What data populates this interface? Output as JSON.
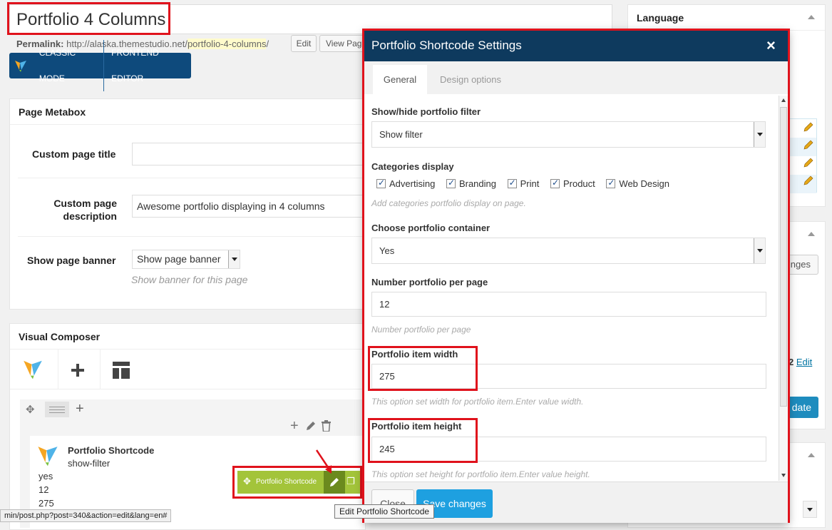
{
  "page": {
    "title": "Portfolio 4 Columns",
    "permalink_label": "Permalink:",
    "permalink_base": "http://alaska.themestudio.net/",
    "permalink_slug": "portfolio-4-columns",
    "permalink_tail": "/",
    "edit_button": "Edit",
    "view_page_button": "View Page",
    "classic_mode": "CLASSIC MODE",
    "frontend_editor": "FRONTEND EDITOR"
  },
  "metabox": {
    "title": "Page Metabox",
    "custom_title_label": "Custom page title",
    "custom_title_value": "",
    "desc_label_1": "Custom page",
    "desc_label_2": "description",
    "desc_value": "Awesome portfolio displaying in 4 columns",
    "banner_label": "Show page banner",
    "banner_value": "Show page banner",
    "banner_hint": "Show banner for this page"
  },
  "composer": {
    "title": "Visual Composer",
    "element_title": "Portfolio Shortcode",
    "element_sub": "show-filter",
    "values": [
      "yes",
      "12",
      "275"
    ],
    "toolbar_label": "Portfolio Shortcode",
    "tooltip": "Edit Portfolio Shortcode"
  },
  "status_url": "min/post.php?post=340&action=edit&lang=en#",
  "sidebar": {
    "language_title": "Language",
    "changes_fragment": "nges",
    "edit_fragment_num": "2",
    "edit_fragment_link": "Edit",
    "update_fragment": "date"
  },
  "modal": {
    "title": "Portfolio Shortcode Settings",
    "close_icon": "×",
    "tabs": [
      "General",
      "Design options"
    ],
    "filter_label": "Show/hide portfolio filter",
    "filter_value": "Show filter",
    "categories_label": "Categories display",
    "categories": [
      "Advertising",
      "Branding",
      "Print",
      "Product",
      "Web Design"
    ],
    "categories_hint": "Add categories portfolio display on page.",
    "container_label": "Choose portfolio container",
    "container_value": "Yes",
    "number_label": "Number portfolio per page",
    "number_value": "12",
    "number_hint": "Number portfolio per page",
    "width_label": "Portfolio item width",
    "width_value": "275",
    "width_hint": "This option set width for portfolio item.Enter value width.",
    "height_label": "Portfolio item height",
    "height_value": "245",
    "height_hint": "This option set height for portfolio item.Enter value height.",
    "close_button": "Close",
    "save_button": "Save changes"
  },
  "colors": {
    "accent_blue": "#1e8cbe",
    "modal_header": "#0e3a5e",
    "vc_green": "#a3c43a",
    "highlight_red": "#e0121c"
  }
}
